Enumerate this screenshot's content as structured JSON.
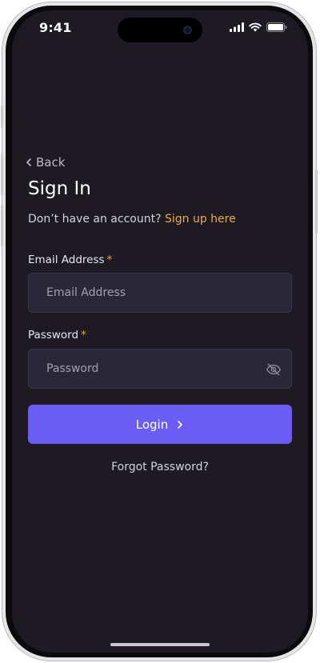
{
  "status": {
    "time": "9:41",
    "icons": [
      "cellular-icon",
      "wifi-icon",
      "battery-icon"
    ]
  },
  "nav": {
    "back_label": "Back"
  },
  "page": {
    "title": "Sign In",
    "signup_prompt": "Don’t have an account?",
    "signup_link": "Sign up here"
  },
  "form": {
    "email": {
      "label": "Email Address",
      "required_mark": "*",
      "placeholder": "Email Address",
      "value": ""
    },
    "password": {
      "label": "Password",
      "required_mark": "*",
      "placeholder": "Password",
      "value": "",
      "toggle_icon": "eye-off-icon"
    },
    "login_label": "Login",
    "forgot_label": "Forgot Password?"
  },
  "colors": {
    "background": "#1d1a24",
    "input_background": "#2a2838",
    "accent": "#f2a93b",
    "primary_button": "#6b5cf6"
  }
}
